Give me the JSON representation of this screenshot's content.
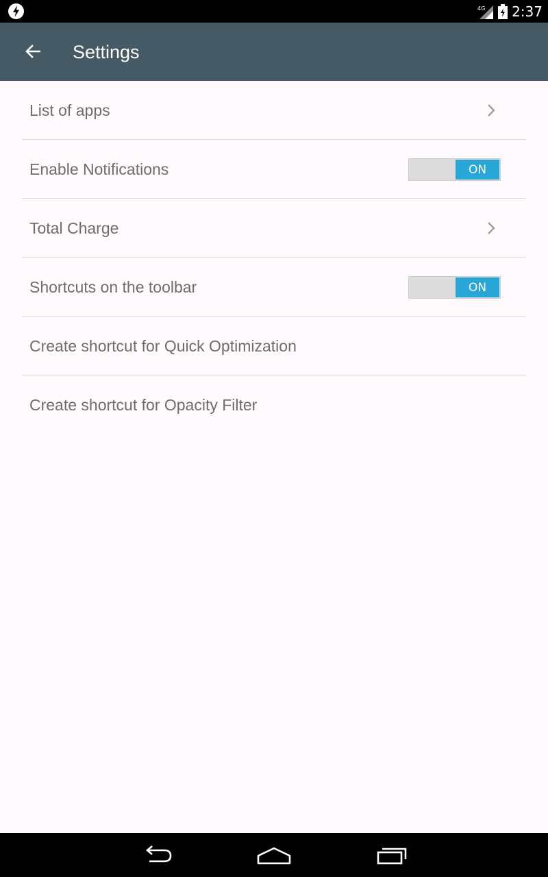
{
  "status_bar": {
    "time": "2:37",
    "network_label": "4G",
    "icons": [
      "bolt-icon",
      "signal-icon",
      "battery-icon"
    ]
  },
  "app_bar": {
    "title": "Settings",
    "back_icon": "arrow-back-icon",
    "background": "#455a64"
  },
  "settings": {
    "items": [
      {
        "label": "List of apps",
        "control": "chevron"
      },
      {
        "label": "Enable Notifications",
        "control": "toggle",
        "state": "ON"
      },
      {
        "label": "Total Charge",
        "control": "chevron"
      },
      {
        "label": "Shortcuts on the toolbar",
        "control": "toggle",
        "state": "ON"
      },
      {
        "label": "Create shortcut for Quick Optimization",
        "control": "none"
      },
      {
        "label": "Create shortcut for Opacity Filter",
        "control": "none"
      }
    ]
  },
  "nav_bar": {
    "buttons": [
      "back-nav-icon",
      "home-nav-icon",
      "recents-nav-icon"
    ]
  },
  "colors": {
    "accent": "#29a6d8",
    "text": "#6d6d6d",
    "divider": "#dcdcdc",
    "page_background": "#fefafd"
  }
}
